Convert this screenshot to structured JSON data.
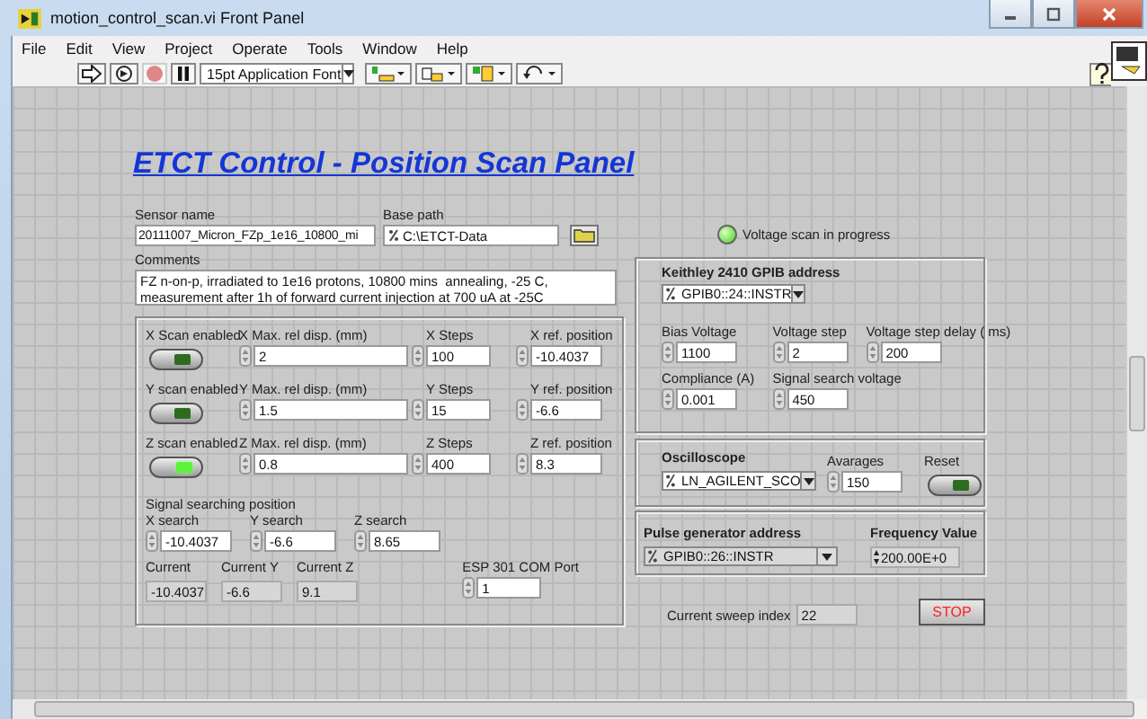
{
  "window": {
    "title": "motion_control_scan.vi Front Panel"
  },
  "menu": [
    "File",
    "Edit",
    "View",
    "Project",
    "Operate",
    "Tools",
    "Window",
    "Help"
  ],
  "toolbar": {
    "font": "15pt Application Font"
  },
  "heading": "ETCT Control - Position Scan Panel",
  "sensor_name": {
    "label": "Sensor name",
    "value": "20111007_Micron_FZp_1e16_10800_mi"
  },
  "base_path": {
    "label": "Base path",
    "value": "C:\\ETCT-Data"
  },
  "comments": {
    "label": "Comments",
    "lines": [
      "FZ n-on-p, irradiated to 1e16 protons, 10800 mins  annealing, -25 C,",
      "measurement after 1h of forward current injection at 700 uA at -25C"
    ]
  },
  "axes": [
    {
      "label": "X Scan enabled",
      "enabled": false,
      "max_label": "X Max. rel disp. (mm)",
      "max_value": "2",
      "steps_label": "X Steps",
      "steps_value": "100",
      "ref_label": "X ref. position",
      "ref_value": "-10.4037"
    },
    {
      "label": "Y scan enabled",
      "enabled": false,
      "max_label": "Y Max. rel disp. (mm)",
      "max_value": "1.5",
      "steps_label": "Y Steps",
      "steps_value": "15",
      "ref_label": "Y ref. position",
      "ref_value": "-6.6"
    },
    {
      "label": "Z scan enabled",
      "enabled": true,
      "max_label": "Z Max. rel disp. (mm)",
      "max_value": "0.8",
      "steps_label": "Z Steps",
      "steps_value": "400",
      "ref_label": "Z ref. position",
      "ref_value": "8.3"
    }
  ],
  "search": {
    "title": "Signal searching position",
    "fields": [
      {
        "label": "X search",
        "value": "-10.4037"
      },
      {
        "label": "Y search",
        "value": "-6.6"
      },
      {
        "label": "Z search",
        "value": "8.65"
      }
    ]
  },
  "current": [
    {
      "label": "Current",
      "value": "-10.4037"
    },
    {
      "label": "Current Y",
      "value": "-6.6"
    },
    {
      "label": "Current Z",
      "value": "9.1"
    }
  ],
  "com_port": {
    "label": "ESP 301 COM Port",
    "value": "1"
  },
  "status_led": {
    "label": "Voltage scan in progress",
    "on": true
  },
  "keithley": {
    "title": "Keithley 2410 GPIB address",
    "address": "GPIB0::24::INSTR",
    "fields": [
      {
        "label": "Bias Voltage",
        "value": "1100"
      },
      {
        "label": "Voltage step",
        "value": "2"
      },
      {
        "label": "Voltage step delay ( ms)",
        "value": "200"
      },
      {
        "label": "Compliance (A)",
        "value": "0.001"
      },
      {
        "label": "Signal search voltage",
        "value": "450"
      }
    ]
  },
  "oscilloscope": {
    "title": "Oscilloscope",
    "resource": "LN_AGILENT_SCO",
    "averages_label": "Avarages",
    "averages": "150",
    "reset_label": "Reset",
    "reset_on": false
  },
  "pulse_generator": {
    "title": "Pulse generator address",
    "address": "GPIB0::26::INSTR",
    "freq_label": "Frequency Value",
    "freq": "200.00E+0"
  },
  "sweep": {
    "label": "Current sweep index",
    "value": "22"
  },
  "stop": "STOP"
}
